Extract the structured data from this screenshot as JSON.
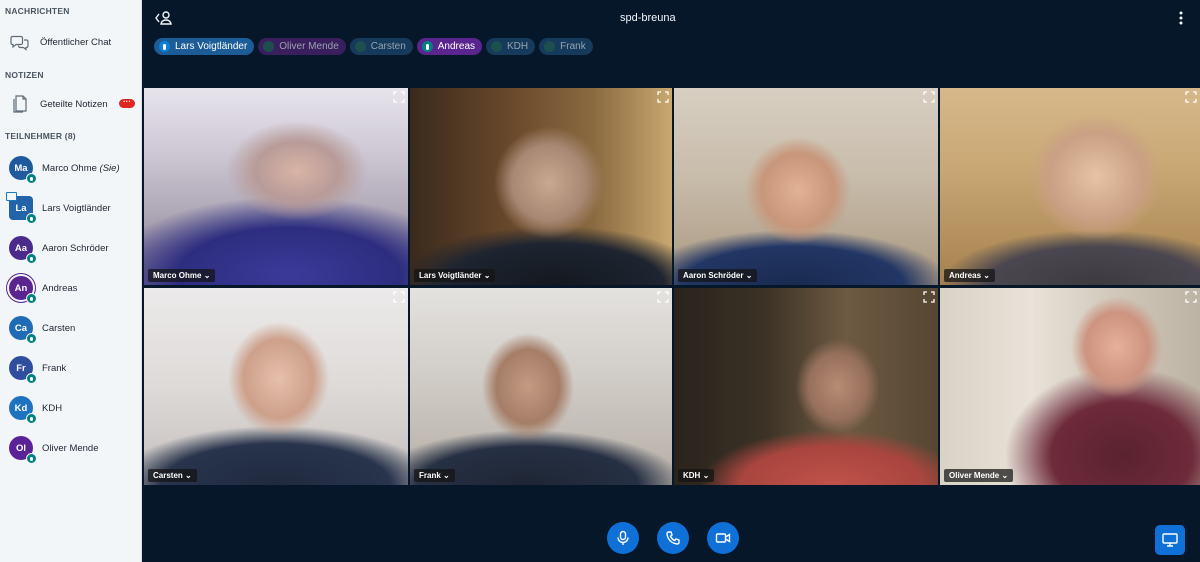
{
  "sidebar": {
    "messages_title": "NACHRICHTEN",
    "public_chat_label": "Öffentlicher Chat",
    "notes_title": "NOTIZEN",
    "shared_notes_label": "Geteilte Notizen",
    "participants_title": "TEILNEHMER (8)",
    "users": [
      {
        "initials": "Ma",
        "name": "Marco Ohme",
        "suffix": "(Sie)",
        "color": "#1f5a9e"
      },
      {
        "initials": "La",
        "name": "Lars Voigtländer",
        "suffix": "",
        "color": "#2364a8"
      },
      {
        "initials": "Aa",
        "name": "Aaron Schröder",
        "suffix": "",
        "color": "#4a2b8c"
      },
      {
        "initials": "An",
        "name": "Andreas",
        "suffix": "",
        "color": "#5a2590"
      },
      {
        "initials": "Ca",
        "name": "Carsten",
        "suffix": "",
        "color": "#1f6bb5"
      },
      {
        "initials": "Fr",
        "name": "Frank",
        "suffix": "",
        "color": "#2f4f9e"
      },
      {
        "initials": "Kd",
        "name": "KDH",
        "suffix": "",
        "color": "#1d73c0"
      },
      {
        "initials": "Ol",
        "name": "Oliver Mende",
        "suffix": "",
        "color": "#5b2298"
      }
    ]
  },
  "header": {
    "title": "spd-breuna"
  },
  "talkers": [
    {
      "name": "Lars Voigtländer",
      "state": "talking",
      "color": "#1c5c97",
      "icon_color": "#0c7fd7"
    },
    {
      "name": "Oliver Mende",
      "state": "muted",
      "color": "#3a1f5e"
    },
    {
      "name": "Carsten",
      "state": "muted",
      "color": "#153a5b"
    },
    {
      "name": "Andreas",
      "state": "talking",
      "color": "#5b2590",
      "icon_color": "#008081"
    },
    {
      "name": "KDH",
      "state": "muted",
      "color": "#153a5b"
    },
    {
      "name": "Frank",
      "state": "muted",
      "color": "#153a5b"
    }
  ],
  "videos": [
    {
      "name": "Marco Ohme"
    },
    {
      "name": "Lars Voigtländer"
    },
    {
      "name": "Aaron Schröder"
    },
    {
      "name": "Andreas"
    },
    {
      "name": "Carsten"
    },
    {
      "name": "Frank"
    },
    {
      "name": "KDH"
    },
    {
      "name": "Oliver Mende"
    }
  ],
  "video_chevron": "⌄",
  "colors": {
    "accent": "#0f70d7",
    "background": "#06172a",
    "sidebar": "#f3f6f9",
    "badge": "#df2721",
    "mic_indicator": "#008081"
  },
  "icons": {
    "chat": "chat-icon",
    "notes": "notes-icon",
    "back": "leave-user-icon",
    "more": "more-vertical-icon",
    "mic": "microphone-icon",
    "phone": "phone-icon",
    "camera": "camera-icon",
    "presentation": "presentation-icon",
    "expand": "fullscreen-icon"
  }
}
